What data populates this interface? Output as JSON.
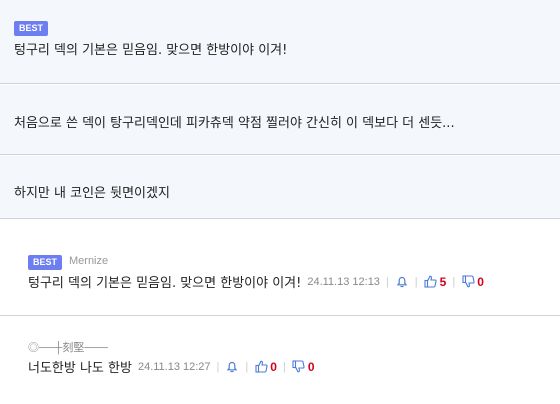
{
  "comments": [
    {
      "badge": "BEST",
      "text": "텅구리 덱의 기본은 믿음임. 맞으면 한방이야 이겨!"
    },
    {
      "text": "처음으로 쓴 덱이 탕구리덱인데 피카츄덱 약점 찔러야 간신히 이 덱보다 더 센듯..."
    },
    {
      "text": "하지만 내 코인은 뒷면이겠지"
    }
  ],
  "replies": [
    {
      "badge": "BEST",
      "author": "Mernize",
      "text": "텅구리 덱의 기본은 믿음임. 맞으면 한방이야 이겨!",
      "time": "24.11.13 12:13",
      "up": "5",
      "down": "0"
    },
    {
      "author": "◎──┼刻堅───",
      "text": "너도한방 나도 한방",
      "time": "24.11.13 12:27",
      "up": "0",
      "down": "0"
    }
  ],
  "colors": {
    "badge": "#6c7ef0",
    "vote": "#4a7bd8",
    "count": "#d0021b"
  }
}
